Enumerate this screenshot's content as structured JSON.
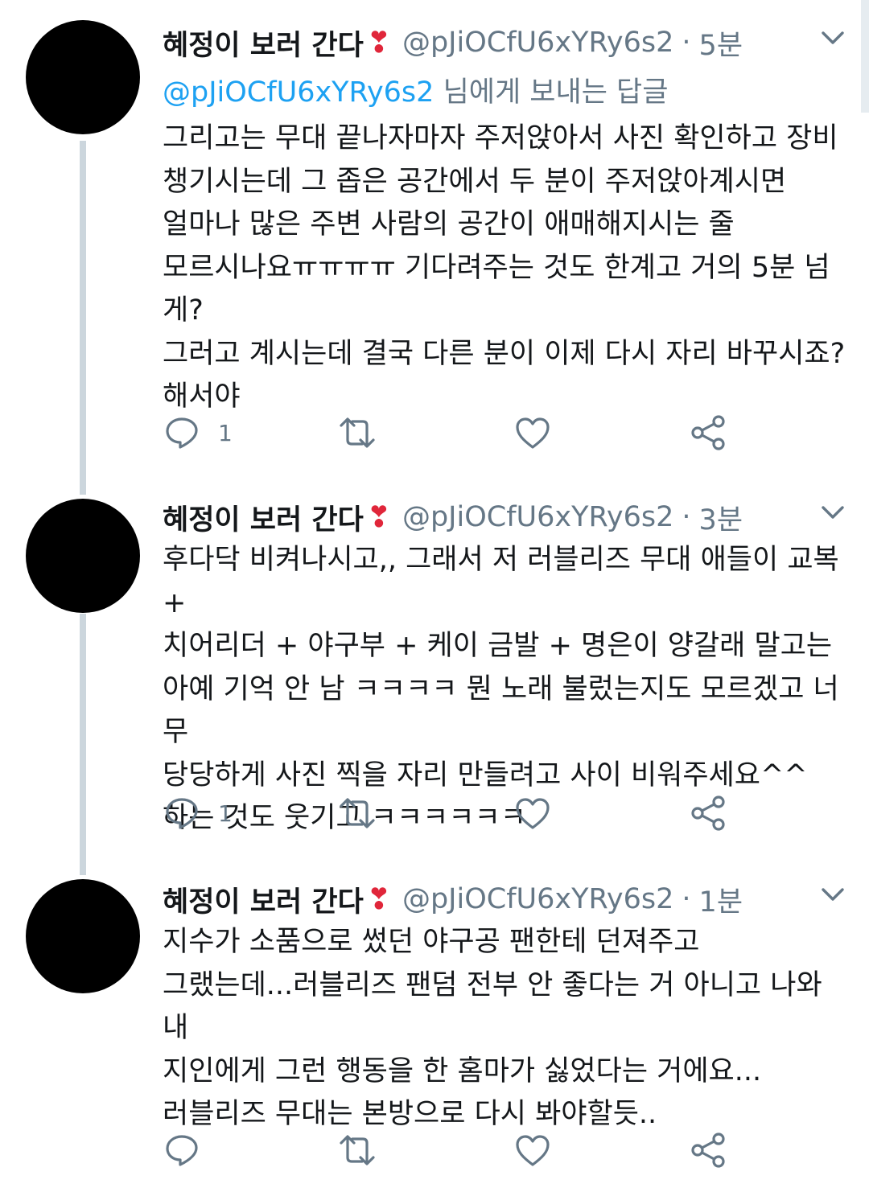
{
  "colors": {
    "name": "#14171a",
    "secondary": "#657786",
    "mention": "#1da1f2",
    "thread_line": "#ccd6dd",
    "heart_emoji": "#e0263a"
  },
  "tweets": [
    {
      "display_name": "혜정이 보러 간다",
      "emoji": "❣",
      "handle": "@pJiOCfU6xYRy6s2",
      "separator": "·",
      "time": "5분",
      "reply_to_mention": "@pJiOCfU6xYRy6s2",
      "reply_to_suffix": " 님에게 보내는 답글",
      "text": "그리고는 무대 끝나자마자 주저앉아서 사진 확인하고 장비\n챙기시는데 그 좁은 공간에서 두 분이 주저앉아계시면\n얼마나 많은 주변 사람의 공간이 애매해지시는 줄\n모르시나요ㅠㅠㅠㅠ 기다려주는 것도 한계고 거의 5분 넘게?\n그러고 계시는데 결국 다른 분이 이제 다시 자리 바꾸시죠?\n해서야",
      "reply_count": "1",
      "icons": {
        "reply": "reply-icon",
        "retweet": "retweet-icon",
        "like": "like-icon",
        "share": "share-icon",
        "more": "chevron-down-icon"
      }
    },
    {
      "display_name": "혜정이 보러 간다",
      "emoji": "❣",
      "handle": "@pJiOCfU6xYRy6s2",
      "separator": "·",
      "time": "3분",
      "text": "후다닥 비켜나시고,, 그래서 저 러블리즈 무대 애들이 교복 +\n치어리더 + 야구부 + 케이 금발 + 명은이 양갈래 말고는\n아예 기억 안 남 ㅋㅋㅋㅋ 뭔 노래 불렀는지도 모르겠고 너무\n당당하게 사진 찍을 자리 만들려고 사이 비워주세요^^\n하는 것도 웃기고 ㅋㅋㅋㅋㅋㅋ",
      "reply_count": "1"
    },
    {
      "display_name": "혜정이 보러 간다",
      "emoji": "❣",
      "handle": "@pJiOCfU6xYRy6s2",
      "separator": "·",
      "time": "1분",
      "text": "지수가 소품으로 썼던 야구공 팬한테 던져주고\n그랬는데...러블리즈 팬덤 전부 안 좋다는 거 아니고 나와 내\n지인에게 그런 행동을 한 홈마가 싫었다는 거에요...\n러블리즈 무대는 본방으로 다시 봐야할듯..",
      "reply_count": ""
    }
  ]
}
